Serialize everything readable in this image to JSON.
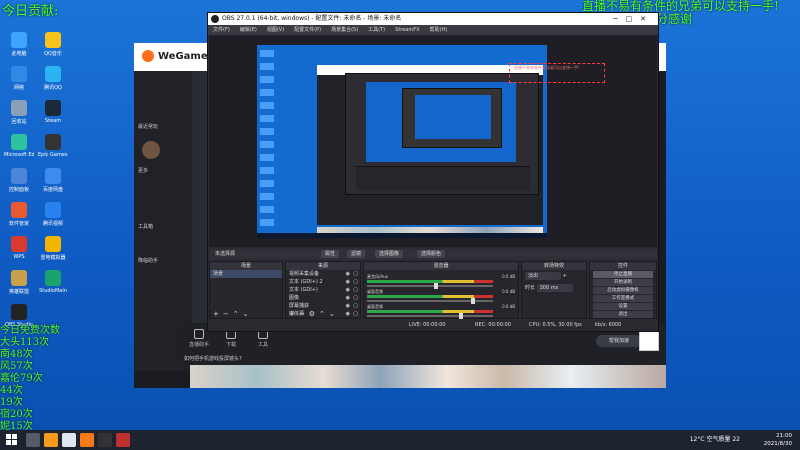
{
  "overlay": {
    "top_left": "今日贡献:",
    "top_right_line1": "直播不易有条件的兄弟可以支持一手!",
    "top_right_line2": "十分感谢",
    "rank_label": "榜面榜:",
    "free_title": "今日免费次数",
    "free_rows": [
      "大头113次",
      "南48次",
      "风57次",
      "嘉伦79次",
      "44次",
      "19次",
      "宿20次",
      "妮15次",
      "千158次",
      "陈叔28次"
    ]
  },
  "desktop_icons": [
    {
      "label": "此电脑",
      "color": "#3fa4ff"
    },
    {
      "label": "QQ音乐",
      "color": "#f7c21c"
    },
    {
      "label": "网络",
      "color": "#2f8ae6"
    },
    {
      "label": "腾讯QQ",
      "color": "#2cb3f3"
    },
    {
      "label": "回收站",
      "color": "#8aa0b8"
    },
    {
      "label": "Steam",
      "color": "#1b2838"
    },
    {
      "label": "Microsoft Edge",
      "color": "#2ec2a0"
    },
    {
      "label": "Epic Games Launcher",
      "color": "#333333"
    },
    {
      "label": "控制面板",
      "color": "#4d85d8"
    },
    {
      "label": "百度网盘",
      "color": "#3c8cf0"
    },
    {
      "label": "软件管家",
      "color": "#e85b30"
    },
    {
      "label": "腾讯视频",
      "color": "#2980ef"
    },
    {
      "label": "WPS",
      "color": "#d83b2b"
    },
    {
      "label": "雷电模拟器",
      "color": "#f2b600"
    },
    {
      "label": "英雄联盟",
      "color": "#c8a24a"
    },
    {
      "label": "StudioMain",
      "color": "#1aa36b"
    },
    {
      "label": "OBS Studio",
      "color": "#222222"
    }
  ],
  "wegame": {
    "logo": "WeGame",
    "side_label_1": "最近常玩",
    "side_label_2": "更多",
    "side_label_3": "工具箱",
    "side_label_4": "降临助手",
    "hint": "如何把手机游戏投屏镜头?",
    "right_button": "帮我加速",
    "bottom_items": [
      "直播助手",
      "下载",
      "工具"
    ]
  },
  "obs": {
    "title": "OBS 27.0.1 (64-bit, windows) - 配置文件: 未命名 - 场景: 未命名",
    "menu": [
      "文件(F)",
      "编辑(E)",
      "视图(V)",
      "配置文件(P)",
      "场景集合(S)",
      "工具(T)",
      "StreamFX",
      "帮助(H)"
    ],
    "context_label": "未选择源",
    "context_buttons": [
      "属性",
      "滤镜",
      "选择图像",
      "选择颜色"
    ],
    "docks": {
      "scenes": "场景",
      "sources": "来源",
      "mixer": "混音器",
      "transitions": "转场特效",
      "controls": "控件"
    },
    "scenes": [
      "场景"
    ],
    "sources": [
      "视频采集设备",
      "文本 (GDI+) 2",
      "文本 (GDI+)",
      "图像",
      "屏幕捕获",
      "媒体源"
    ],
    "mixer": [
      {
        "name": "麦克风/Aux",
        "db": "0.0 dB",
        "level": 0.55
      },
      {
        "name": "桌面音频",
        "db": "0.0 dB",
        "level": 0.85
      },
      {
        "name": "桌面音频",
        "db": "0.0 dB",
        "level": 0.75
      }
    ],
    "transition_type": "淡出",
    "duration_label": "时长",
    "duration_value": "300 ms",
    "controls": [
      "停止直播",
      "开始录制",
      "启动虚拟摄像机",
      "工作室模式",
      "设置",
      "退出"
    ],
    "status": {
      "live": "LIVE: 00:00:00",
      "rec": "REC: 00:00:00",
      "cpu": "CPU: 0.5%, 30.00 fps",
      "dropped": "丢帧 0 (0.0%)",
      "kbps": "kb/s: 6000"
    }
  },
  "taskbar": {
    "weather": "12°C 空气质量 22",
    "time": "21:00",
    "date": "2021/8/30",
    "apps": [
      {
        "name": "search",
        "color": "#555a66"
      },
      {
        "name": "orange-app",
        "color": "#f59a1a"
      },
      {
        "name": "fan-app",
        "color": "#dfe6ee"
      },
      {
        "name": "wegame",
        "color": "#ff7a1a"
      },
      {
        "name": "obs",
        "color": "#333333"
      },
      {
        "name": "netease",
        "color": "#c03030"
      }
    ]
  }
}
